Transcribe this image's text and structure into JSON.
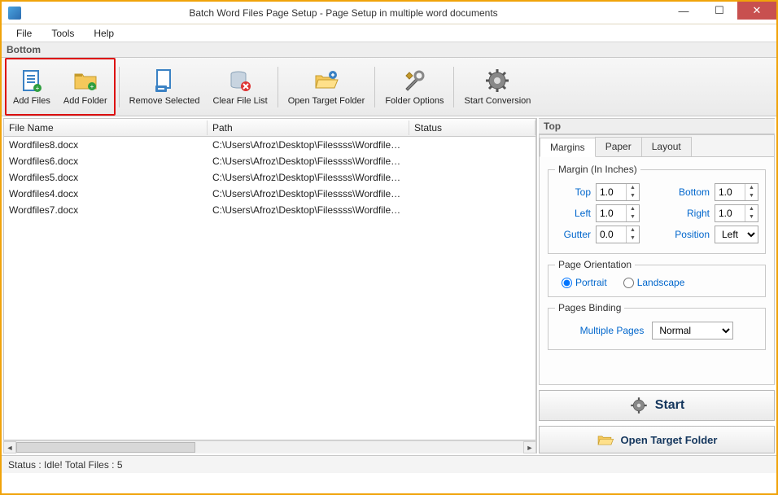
{
  "window": {
    "title": "Batch Word Files Page Setup - Page Setup in multiple word documents"
  },
  "menu": {
    "file": "File",
    "tools": "Tools",
    "help": "Help"
  },
  "section_bottom": "Bottom",
  "section_top": "Top",
  "toolbar": {
    "add_files": "Add Files",
    "add_folder": "Add Folder",
    "remove_selected": "Remove Selected",
    "clear_list": "Clear File List",
    "open_target": "Open Target Folder",
    "folder_options": "Folder Options",
    "start_conversion": "Start Conversion"
  },
  "table": {
    "headers": {
      "filename": "File Name",
      "path": "Path",
      "status": "Status"
    },
    "rows": [
      {
        "filename": "Wordfiles8.docx",
        "path": "C:\\Users\\Afroz\\Desktop\\Filessss\\Wordfiles8...",
        "status": ""
      },
      {
        "filename": "Wordfiles6.docx",
        "path": "C:\\Users\\Afroz\\Desktop\\Filessss\\Wordfiles6...",
        "status": ""
      },
      {
        "filename": "Wordfiles5.docx",
        "path": "C:\\Users\\Afroz\\Desktop\\Filessss\\Wordfiles5...",
        "status": ""
      },
      {
        "filename": "Wordfiles4.docx",
        "path": "C:\\Users\\Afroz\\Desktop\\Filessss\\Wordfiles4...",
        "status": ""
      },
      {
        "filename": "Wordfiles7.docx",
        "path": "C:\\Users\\Afroz\\Desktop\\Filessss\\Wordfiles7...",
        "status": ""
      }
    ]
  },
  "tabs": {
    "margins": "Margins",
    "paper": "Paper",
    "layout": "Layout"
  },
  "margins": {
    "legend": "Margin (In Inches)",
    "top_label": "Top",
    "top": "1.0",
    "bottom_label": "Bottom",
    "bottom": "1.0",
    "left_label": "Left",
    "left": "1.0",
    "right_label": "Right",
    "right": "1.0",
    "gutter_label": "Gutter",
    "gutter": "0.0",
    "position_label": "Position",
    "position": "Left"
  },
  "orientation": {
    "legend": "Page Orientation",
    "portrait": "Portrait",
    "landscape": "Landscape",
    "selected": "portrait"
  },
  "binding": {
    "legend": "Pages Binding",
    "label": "Multiple Pages",
    "value": "Normal"
  },
  "start_button": "Start",
  "open_target_button": "Open Target Folder",
  "status": "Status  :  Idle!  Total Files : 5"
}
